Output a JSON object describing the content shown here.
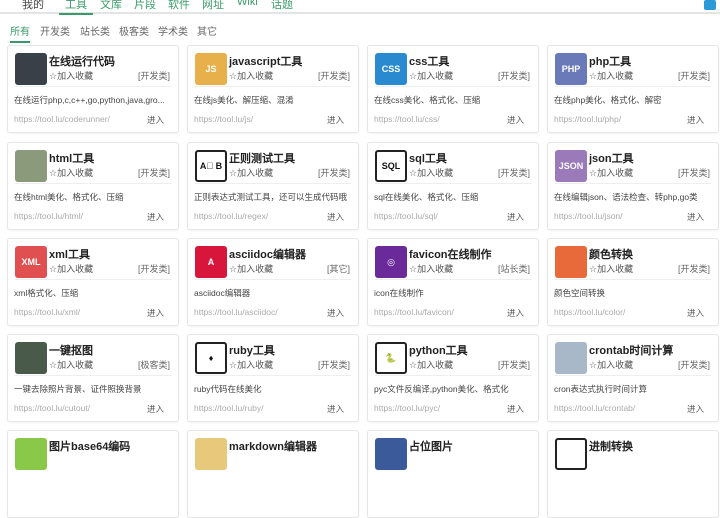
{
  "nav": {
    "items": [
      "我的",
      "工具",
      "文库",
      "片段",
      "软件",
      "网址",
      "Wiki",
      "话题"
    ],
    "active": 1
  },
  "tabs": {
    "items": [
      "所有",
      "开发类",
      "站长类",
      "极客类",
      "学术类",
      "其它"
    ],
    "active": 0
  },
  "fav_label": "☆加入收藏",
  "enter_label": "进入",
  "cards": [
    {
      "title": "在线运行代码",
      "cat": "[开发类]",
      "desc": "在线运行php,c,c++,go,python,java,gro...",
      "url": "https://tool.lu/coderunner/",
      "icon": "code-editor-icon",
      "icon_text": "",
      "color": "#3a4048"
    },
    {
      "title": "javascript工具",
      "cat": "[开发类]",
      "desc": "在线js美化、解压缩、混淆",
      "url": "https://tool.lu/js/",
      "icon": "js-file-icon",
      "icon_text": "JS",
      "color": "#e8b04a"
    },
    {
      "title": "css工具",
      "cat": "[开发类]",
      "desc": "在线css美化、格式化、压缩",
      "url": "https://tool.lu/css/",
      "icon": "css-file-icon",
      "icon_text": "CSS",
      "color": "#2a8ad0"
    },
    {
      "title": "php工具",
      "cat": "[开发类]",
      "desc": "在线php美化、格式化、解密",
      "url": "https://tool.lu/php/",
      "icon": "php-icon",
      "icon_text": "PHP",
      "color": "#6a7ab8"
    },
    {
      "title": "html工具",
      "cat": "[开发类]",
      "desc": "在线html美化、格式化、压缩",
      "url": "https://tool.lu/html/",
      "icon": "html-editor-icon",
      "icon_text": "",
      "color": "#8a9a7a"
    },
    {
      "title": "正则测试工具",
      "cat": "[开发类]",
      "desc": "正则表达式测试工具，还可以生成代码哦",
      "url": "https://tool.lu/regex/",
      "icon": "regex-icon",
      "icon_text": "A⃝ B",
      "color": "#ffffff"
    },
    {
      "title": "sql工具",
      "cat": "[开发类]",
      "desc": "sql在线美化、格式化、压缩",
      "url": "https://tool.lu/sql/",
      "icon": "sql-icon",
      "icon_text": "SQL",
      "color": "#ffffff"
    },
    {
      "title": "json工具",
      "cat": "[开发类]",
      "desc": "在线编辑json、语法检查、转php,go类",
      "url": "https://tool.lu/json/",
      "icon": "json-file-icon",
      "icon_text": "JSON",
      "color": "#9a7ab8"
    },
    {
      "title": "xml工具",
      "cat": "[开发类]",
      "desc": "xml格式化、压缩",
      "url": "https://tool.lu/xml/",
      "icon": "xml-file-icon",
      "icon_text": "XML",
      "color": "#e05050"
    },
    {
      "title": "asciidoc编辑器",
      "cat": "[其它]",
      "desc": "asciidoc编辑器",
      "url": "https://tool.lu/asciidoc/",
      "icon": "asciidoc-icon",
      "icon_text": "A",
      "color": "#d8163c"
    },
    {
      "title": "favicon在线制作",
      "cat": "[站长类]",
      "desc": "icon在线制作",
      "url": "https://tool.lu/favicon/",
      "icon": "instagram-like-icon",
      "icon_text": "◎",
      "color": "#6a2a9a"
    },
    {
      "title": "颜色转换",
      "cat": "[开发类]",
      "desc": "颜色空间转换",
      "url": "https://tool.lu/color/",
      "icon": "color-palette-icon",
      "icon_text": "",
      "color": "#e86a3a"
    },
    {
      "title": "一键抠图",
      "cat": "[极客类]",
      "desc": "一键去除照片背景、证件照换背景",
      "url": "https://tool.lu/cutout/",
      "icon": "portrait-icon",
      "icon_text": "",
      "color": "#4a5a4a"
    },
    {
      "title": "ruby工具",
      "cat": "[开发类]",
      "desc": "ruby代码在线美化",
      "url": "https://tool.lu/ruby/",
      "icon": "ruby-icon",
      "icon_text": "♦",
      "color": "#ffffff"
    },
    {
      "title": "python工具",
      "cat": "[开发类]",
      "desc": "pyc文件反编译,python美化、格式化",
      "url": "https://tool.lu/pyc/",
      "icon": "python-icon",
      "icon_text": "🐍",
      "color": "#ffffff"
    },
    {
      "title": "crontab时间计算",
      "cat": "[开发类]",
      "desc": "cron表达式执行时间计算",
      "url": "https://tool.lu/crontab/",
      "icon": "crontab-icon",
      "icon_text": "",
      "color": "#a8b8c8"
    },
    {
      "title": "图片base64编码",
      "cat": "",
      "desc": "",
      "url": "",
      "icon": "image-icon",
      "icon_text": "",
      "color": "#8ac84a"
    },
    {
      "title": "markdown编辑器",
      "cat": "",
      "desc": "",
      "url": "",
      "icon": "markdown-icon",
      "icon_text": "",
      "color": "#e8c87a"
    },
    {
      "title": "占位图片",
      "cat": "",
      "desc": "",
      "url": "",
      "icon": "placeholder-image-icon",
      "icon_text": "",
      "color": "#3a5a9a"
    },
    {
      "title": "进制转换",
      "cat": "",
      "desc": "",
      "url": "",
      "icon": "base-convert-icon",
      "icon_text": "",
      "color": "#ffffff"
    }
  ]
}
